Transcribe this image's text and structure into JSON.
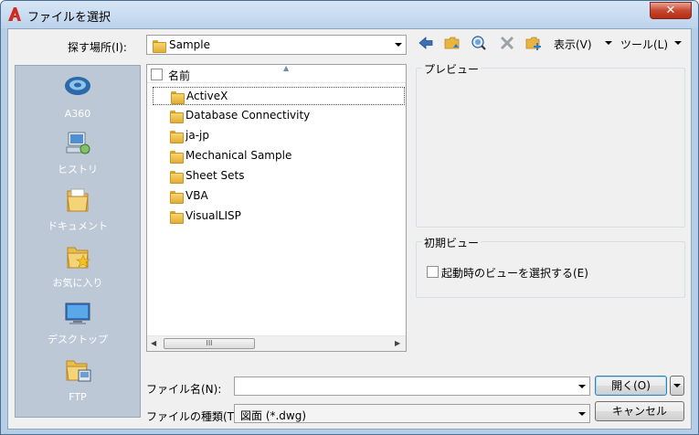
{
  "window": {
    "title": "ファイルを選択",
    "close_label": "✕"
  },
  "lookin": {
    "label": "探す場所(I):",
    "value": "Sample"
  },
  "toolbar": {
    "view_label": "表示(V)",
    "tools_label": "ツール(L)"
  },
  "places": [
    {
      "label": "A360",
      "icon": "a360-icon"
    },
    {
      "label": "ヒストリ",
      "icon": "history-icon"
    },
    {
      "label": "ドキュメント",
      "icon": "documents-icon"
    },
    {
      "label": "お気に入り",
      "icon": "favorites-icon"
    },
    {
      "label": "デスクトップ",
      "icon": "desktop-icon"
    },
    {
      "label": "FTP",
      "icon": "ftp-icon"
    }
  ],
  "filelist": {
    "column_name": "名前",
    "scroll_thumb": "III",
    "items": [
      "ActiveX",
      "Database Connectivity",
      "ja-jp",
      "Mechanical Sample",
      "Sheet Sets",
      "VBA",
      "VisualLISP"
    ]
  },
  "preview": {
    "title": "プレビュー"
  },
  "initial_view": {
    "title": "初期ビュー",
    "checkbox_label": "起動時のビューを選択する(E)"
  },
  "filename": {
    "label": "ファイル名(N):",
    "value": ""
  },
  "filetype": {
    "label": "ファイルの種類(T):",
    "value": "図面 (*.dwg)"
  },
  "buttons": {
    "open": "開く(O)",
    "cancel": "キャンセル"
  },
  "colors": {
    "window_frame": "#b6cde6",
    "places_bg": "#bcc8d6",
    "accent_blue": "#3b6fb6"
  }
}
